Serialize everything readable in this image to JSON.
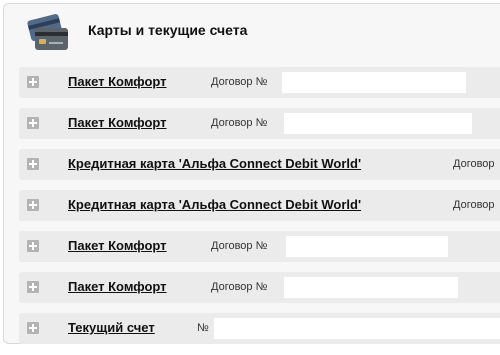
{
  "section": {
    "title": "Карты и текущие счета",
    "icon": "credit-cards-icon"
  },
  "accounts": [
    {
      "product": "Пакет Комфорт",
      "contract": "Договор №"
    },
    {
      "product": "Пакет Комфорт",
      "contract": "Договор №"
    },
    {
      "product": "Кредитная карта 'Альфа Connect Debit World'",
      "contract": "Договор"
    },
    {
      "product": "Кредитная карта 'Альфа Connect Debit World'",
      "contract": "Договор"
    },
    {
      "product": "Пакет Комфорт",
      "contract": "Договор №"
    },
    {
      "product": "Пакет Комфорт",
      "contract": "Договор №"
    },
    {
      "product": "Текущий счет",
      "contract": "№"
    }
  ],
  "expand_icon": "plus-icon",
  "colors": {
    "panel_bg": "#f7f7f7",
    "row_bg": "#ebebeb",
    "expand_icon": "#b3b3b3"
  }
}
